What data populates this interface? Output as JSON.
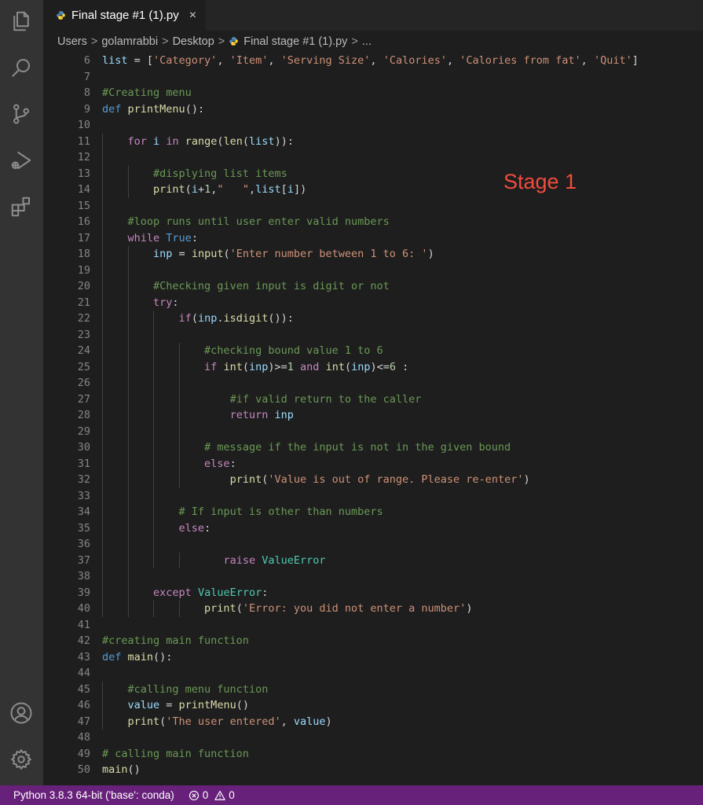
{
  "tab": {
    "label": "Final stage #1 (1).py",
    "close": "×"
  },
  "breadcrumb": {
    "items": [
      "Users",
      "golamrabbi",
      "Desktop"
    ],
    "file": "Final stage #1 (1).py",
    "trail": "...",
    "separator": ">"
  },
  "annotation": {
    "text": "Stage 1"
  },
  "code_lines": [
    {
      "n": "6",
      "t": "list = ['Category', 'Item', 'Serving Size', 'Calories', 'Calories from fat', 'Quit']"
    },
    {
      "n": "7",
      "t": ""
    },
    {
      "n": "8",
      "t": "#Creating menu"
    },
    {
      "n": "9",
      "t": "def printMenu():"
    },
    {
      "n": "10",
      "t": ""
    },
    {
      "n": "11",
      "t": "    for i in range(len(list)):"
    },
    {
      "n": "12",
      "t": ""
    },
    {
      "n": "13",
      "t": "        #displying list items"
    },
    {
      "n": "14",
      "t": "        print(i+1,\"   \",list[i])"
    },
    {
      "n": "15",
      "t": ""
    },
    {
      "n": "16",
      "t": "    #loop runs until user enter valid numbers"
    },
    {
      "n": "17",
      "t": "    while True:"
    },
    {
      "n": "18",
      "t": "        inp = input('Enter number between 1 to 6: ')"
    },
    {
      "n": "19",
      "t": ""
    },
    {
      "n": "20",
      "t": "        #Checking given input is digit or not"
    },
    {
      "n": "21",
      "t": "        try:"
    },
    {
      "n": "22",
      "t": "            if(inp.isdigit()):"
    },
    {
      "n": "23",
      "t": ""
    },
    {
      "n": "24",
      "t": "                #checking bound value 1 to 6"
    },
    {
      "n": "25",
      "t": "                if int(inp)>=1 and int(inp)<=6 :"
    },
    {
      "n": "26",
      "t": ""
    },
    {
      "n": "27",
      "t": "                    #if valid return to the caller"
    },
    {
      "n": "28",
      "t": "                    return inp"
    },
    {
      "n": "29",
      "t": ""
    },
    {
      "n": "30",
      "t": "                # message if the input is not in the given bound"
    },
    {
      "n": "31",
      "t": "                else:"
    },
    {
      "n": "32",
      "t": "                    print('Value is out of range. Please re-enter')"
    },
    {
      "n": "33",
      "t": ""
    },
    {
      "n": "34",
      "t": "            # If input is other than numbers"
    },
    {
      "n": "35",
      "t": "            else:"
    },
    {
      "n": "36",
      "t": ""
    },
    {
      "n": "37",
      "t": "                   raise ValueError"
    },
    {
      "n": "38",
      "t": ""
    },
    {
      "n": "39",
      "t": "        except ValueError:"
    },
    {
      "n": "40",
      "t": "                print('Error: you did not enter a number')"
    },
    {
      "n": "41",
      "t": ""
    },
    {
      "n": "42",
      "t": "#creating main function"
    },
    {
      "n": "43",
      "t": "def main():"
    },
    {
      "n": "44",
      "t": ""
    },
    {
      "n": "45",
      "t": "    #calling menu function"
    },
    {
      "n": "46",
      "t": "    value = printMenu()"
    },
    {
      "n": "47",
      "t": "    print('The user entered', value)"
    },
    {
      "n": "48",
      "t": ""
    },
    {
      "n": "49",
      "t": "# calling main function"
    },
    {
      "n": "50",
      "t": "main()"
    }
  ],
  "status": {
    "interpreter": "Python 3.8.3 64-bit ('base': conda)",
    "errors": "0",
    "warnings": "0"
  },
  "colors": {
    "keyword": "#569cd6",
    "control": "#c586c0",
    "string": "#ce9178",
    "comment": "#6a9955",
    "function": "#dcdcaa",
    "type": "#4ec9b0",
    "variable": "#9cdcfe",
    "number": "#b5cea8",
    "statusbar": "#68217a",
    "annotation": "#f14c3c"
  },
  "icons": [
    "files-icon",
    "search-icon",
    "source-control-icon",
    "run-debug-icon",
    "extensions-icon",
    "account-icon",
    "settings-gear-icon",
    "python-file-icon",
    "error-icon",
    "warning-icon"
  ]
}
